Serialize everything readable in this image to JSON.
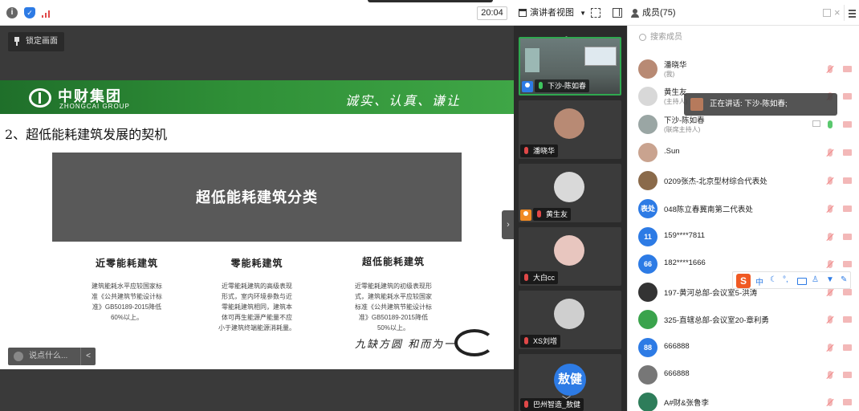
{
  "topbar": {
    "timer": "20:04",
    "presenter_view": "演讲者视图",
    "members_title": "成员(75)"
  },
  "stage": {
    "lock_label": "锁定画面",
    "chat_placeholder": "说点什么..."
  },
  "slide": {
    "logo_cn": "中财集团",
    "logo_en": "ZHONGCAI GROUP",
    "slogan": "诚实、认真、谦让",
    "subtitle": "2、超低能耗建筑发展的契机",
    "category_title": "超低能耗建筑分类",
    "columns": [
      {
        "title": "近零能耗建筑",
        "body": [
          "建筑能耗水平应较国家标",
          "准《公共建筑节能设计标",
          "准》GB50189-2015降低",
          "60%以上。"
        ]
      },
      {
        "title": "零能耗建筑",
        "body": [
          "近零能耗建筑的高级表现",
          "形式，室内环境参数与近",
          "零能耗建筑相同，建筑本",
          "体可再生能源产能量不应",
          "小于建筑终端能源消耗量。"
        ]
      },
      {
        "title": "超低能耗建筑",
        "body": [
          "近零能耗建筑的初级表现形",
          "式，建筑能耗水平应较国家",
          "标准《公共建筑节能设计标",
          "准》GB50189-2015降低",
          "50%以上。"
        ]
      }
    ],
    "brush_text": "九缺方圆 和而为一"
  },
  "video_tiles": [
    {
      "name": "下沙-陈如春"
    },
    {
      "name": "潘晓华"
    },
    {
      "name": "黄生友"
    },
    {
      "name": "大白cc"
    },
    {
      "name": "XS刘增"
    },
    {
      "name": "巴州智造_敖健",
      "avatar_text": "敖健"
    }
  ],
  "members": {
    "search_placeholder": "搜索成员",
    "speaking_now": "正在讲话: 下沙-陈如春;",
    "list": [
      {
        "name": "潘晓华",
        "role": "(我)"
      },
      {
        "name": "黄生友",
        "role": "(主持人)"
      },
      {
        "name": "下沙-陈如春",
        "role": "(联席主持人)"
      },
      {
        "name": ".Sun",
        "role": ""
      },
      {
        "name": "0209张杰-北京型材综合代表处",
        "role": ""
      },
      {
        "name": "048陈立春冀南第二代表处",
        "role": "",
        "avatar_text": "表处"
      },
      {
        "name": "159****7811",
        "role": "",
        "avatar_text": "11"
      },
      {
        "name": "182****1666",
        "role": "",
        "avatar_text": "66"
      },
      {
        "name": "197-黄河总部-会议室5-洪涛",
        "role": ""
      },
      {
        "name": "325-直辖总部-会议室20-章利勇",
        "role": ""
      },
      {
        "name": "666888",
        "role": "",
        "avatar_text": "88"
      },
      {
        "name": "666888",
        "role": ""
      },
      {
        "name": "A#财&张鲁李",
        "role": ""
      }
    ]
  },
  "ime": {
    "logo": "S",
    "lang": "中"
  },
  "colors": {
    "brand_green": "#2f8f37",
    "accent_blue": "#2d7be5",
    "mic_red": "#e04848"
  }
}
